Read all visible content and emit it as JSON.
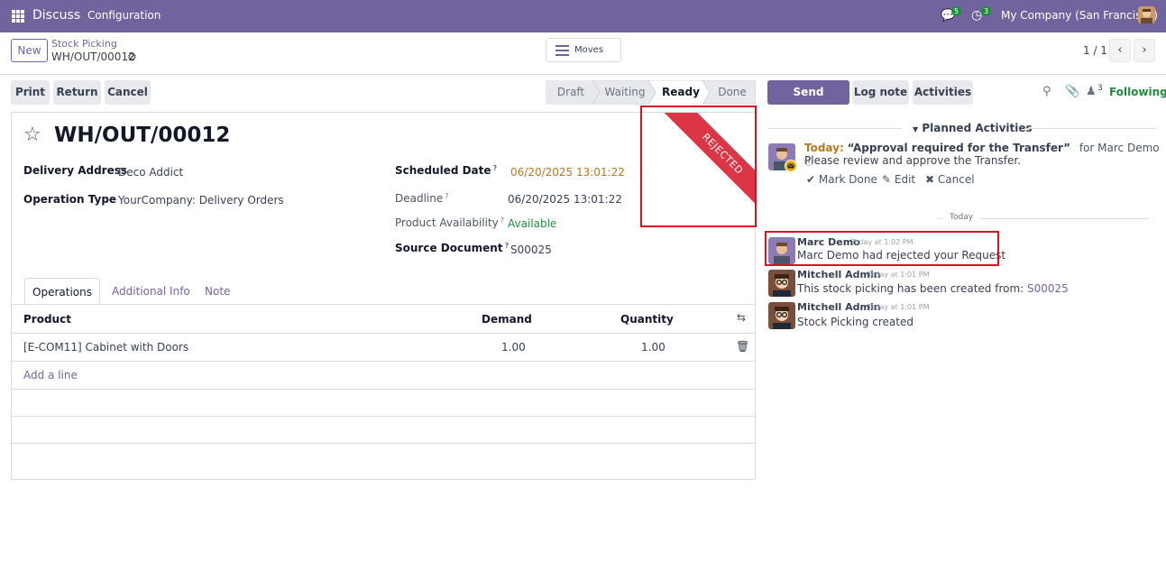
{
  "topbar": {
    "app_name": "Discuss",
    "menu_config": "Configuration",
    "chat_count": "5",
    "activity_count": "3",
    "company": "My Company (San Francisco)"
  },
  "control_panel": {
    "new_label": "New",
    "breadcrumb": "Stock Picking",
    "record_name": "WH/OUT/00012",
    "moves_label": "Moves",
    "pager": "1 / 1"
  },
  "actions": {
    "print": "Print",
    "return": "Return",
    "cancel": "Cancel"
  },
  "statusbar": {
    "steps": [
      "Draft",
      "Waiting",
      "Ready",
      "Done"
    ],
    "active": "Ready"
  },
  "form": {
    "title": "WH/OUT/00012",
    "ribbon": "REJECTED",
    "delivery_address_label": "Delivery Address",
    "delivery_address": "Deco Addict",
    "operation_type_label": "Operation Type",
    "operation_type": "YourCompany: Delivery Orders",
    "scheduled_date_label": "Scheduled Date",
    "scheduled_date": "06/20/2025 13:01:22",
    "deadline_label": "Deadline",
    "deadline": "06/20/2025 13:01:22",
    "availability_label": "Product Availability",
    "availability": "Available",
    "source_doc_label": "Source Document",
    "source_doc": "S00025",
    "help_mark": "?",
    "tabs": [
      "Operations",
      "Additional Info",
      "Note"
    ],
    "columns": [
      "Product",
      "Demand",
      "Quantity"
    ],
    "rows": [
      {
        "product": "[E-COM11] Cabinet with Doors",
        "demand": "1.00",
        "quantity": "1.00"
      }
    ],
    "add_line": "Add a line"
  },
  "chatter": {
    "send_message": "Send message",
    "log_note": "Log note",
    "activities": "Activities",
    "followers_count": "3",
    "following": "Following",
    "planned_activities": "Planned Activities",
    "activity": {
      "when": "Today:",
      "summary": "“Approval required for the Transfer”",
      "for": "for Marc Demo",
      "note": "Please review and approve the Transfer.",
      "mark_done": "Mark Done",
      "edit": "Edit",
      "cancel": "Cancel"
    },
    "today_label": "Today",
    "messages": [
      {
        "author": "Marc Demo",
        "time": "Today at 1:02 PM",
        "body": "Marc Demo had rejected your Request",
        "link": ""
      },
      {
        "author": "Mitchell Admin",
        "time": "Today at 1:01 PM",
        "body": "This stock picking has been created from: ",
        "link": "S00025"
      },
      {
        "author": "Mitchell Admin",
        "time": "Today at 1:01 PM",
        "body": "Stock Picking created",
        "link": ""
      }
    ]
  },
  "colors": {
    "brand": "#71639e",
    "ribbon": "#dc3545",
    "success": "#1e8e3e",
    "highlight": "#d9121f"
  }
}
